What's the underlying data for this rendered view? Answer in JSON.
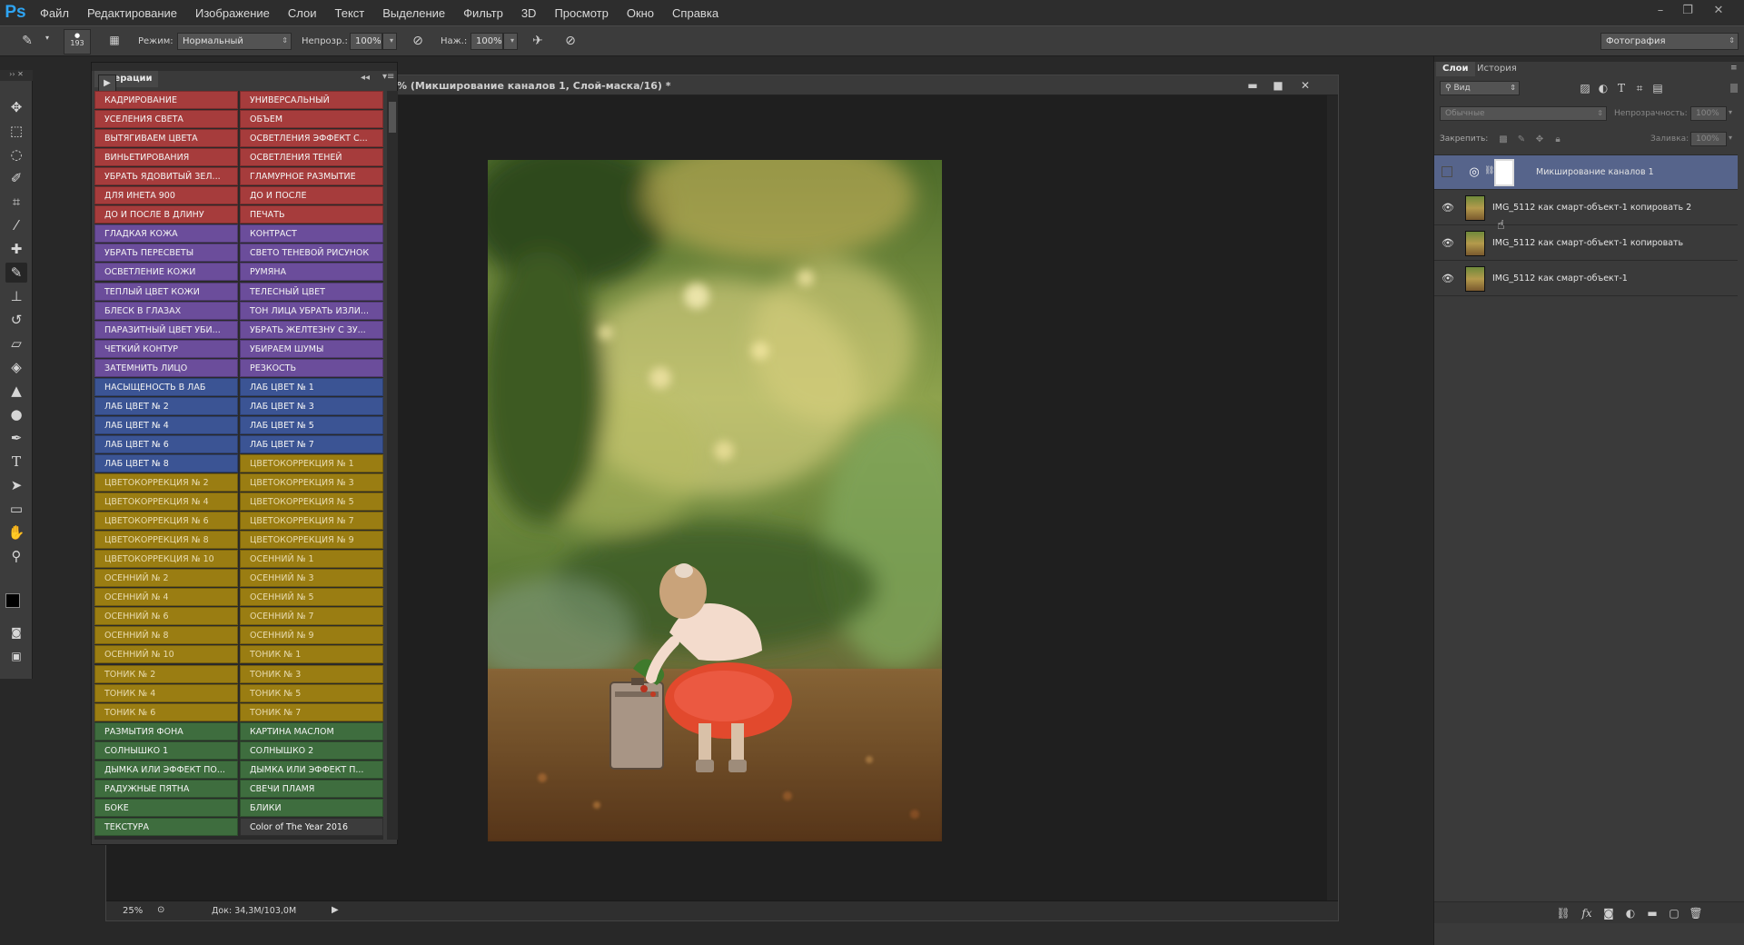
{
  "app": {
    "logo": "Ps"
  },
  "menu": [
    "Файл",
    "Редактирование",
    "Изображение",
    "Слои",
    "Текст",
    "Выделение",
    "Фильтр",
    "3D",
    "Просмотр",
    "Окно",
    "Справка"
  ],
  "options": {
    "brush_size": "193",
    "mode_label": "Режим:",
    "mode_value": "Нормальный",
    "opacity_label": "Непрозр.:",
    "opacity_value": "100%",
    "pressure_label": "Наж.:",
    "pressure_value": "100%",
    "workspace": "Фотография"
  },
  "document": {
    "title": "% (Микширование каналов 1, Слой-маска/16) *",
    "zoom": "25%",
    "doc_info": "Док: 34,3M/103,0M"
  },
  "actions_panel": {
    "tab": "Операции",
    "rows": [
      [
        "КАДРИРОВАНИЕ",
        "УНИВЕРСАЛЬНЫЙ",
        "red"
      ],
      [
        "УСЕЛЕНИЯ СВЕТА",
        "ОБЪЕМ",
        "red"
      ],
      [
        "ВЫТЯГИВАЕМ ЦВЕТА",
        "ОСВЕТЛЕНИЯ ЭФФЕКТ С...",
        "red"
      ],
      [
        "ВИНЬЕТИРОВАНИЯ",
        "ОСВЕТЛЕНИЯ ТЕНЕЙ",
        "red"
      ],
      [
        "УБРАТЬ ЯДОВИТЫЙ ЗЕЛ...",
        "ГЛАМУРНОЕ РАЗМЫТИЕ",
        "red"
      ],
      [
        "ДЛЯ ИНЕТА 900",
        "ДО И ПОСЛЕ",
        "red"
      ],
      [
        "ДО И ПОСЛЕ В ДЛИНУ",
        "ПЕЧАТЬ",
        "red"
      ],
      [
        "ГЛАДКАЯ КОЖА",
        "КОНТРАСТ",
        "purple"
      ],
      [
        "УБРАТЬ ПЕРЕСВЕТЫ",
        "СВЕТО ТЕНЕВОЙ РИСУНОК",
        "purple"
      ],
      [
        "ОСВЕТЛЕНИЕ КОЖИ",
        "РУМЯНА",
        "purple"
      ],
      [
        "ТЕПЛЫЙ ЦВЕТ КОЖИ",
        "ТЕЛЕСНЫЙ ЦВЕТ",
        "purple"
      ],
      [
        "БЛЕСК В ГЛАЗАХ",
        "ТОН ЛИЦА УБРАТЬ ИЗЛИ...",
        "purple"
      ],
      [
        "ПАРАЗИТНЫЙ ЦВЕТ УБИ...",
        "УБРАТЬ ЖЕЛТЕЗНУ С ЗУ...",
        "purple"
      ],
      [
        "ЧЕТКИЙ КОНТУР",
        "УБИРАЕМ ШУМЫ",
        "purple"
      ],
      [
        "ЗАТЕМНИТЬ ЛИЦО",
        "РЕЗКОСТЬ",
        "purple"
      ],
      [
        "НАСЫЩЕНОСТЬ В ЛАБ",
        "ЛАБ ЦВЕТ № 1",
        "blue"
      ],
      [
        "ЛАБ ЦВЕТ № 2",
        "ЛАБ ЦВЕТ № 3",
        "blue"
      ],
      [
        "ЛАБ ЦВЕТ № 4",
        "ЛАБ ЦВЕТ № 5",
        "blue"
      ],
      [
        "ЛАБ ЦВЕТ № 6",
        "ЛАБ ЦВЕТ № 7",
        "blue"
      ],
      [
        "ЛАБ ЦВЕТ № 8",
        "ЦВЕТОКОРРЕКЦИЯ № 1",
        "blue|yellow"
      ],
      [
        "ЦВЕТОКОРРЕКЦИЯ № 2",
        "ЦВЕТОКОРРЕКЦИЯ № 3",
        "yellow"
      ],
      [
        "ЦВЕТОКОРРЕКЦИЯ № 4",
        "ЦВЕТОКОРРЕКЦИЯ № 5",
        "yellow"
      ],
      [
        "ЦВЕТОКОРРЕКЦИЯ № 6",
        "ЦВЕТОКОРРЕКЦИЯ № 7",
        "yellow"
      ],
      [
        "ЦВЕТОКОРРЕКЦИЯ № 8",
        "ЦВЕТОКОРРЕКЦИЯ № 9",
        "yellow"
      ],
      [
        "ЦВЕТОКОРРЕКЦИЯ № 10",
        "ОСЕННИЙ № 1",
        "yellow"
      ],
      [
        "ОСЕННИЙ № 2",
        "ОСЕННИЙ № 3",
        "yellow"
      ],
      [
        "ОСЕННИЙ № 4",
        "ОСЕННИЙ № 5",
        "yellow"
      ],
      [
        "ОСЕННИЙ № 6",
        "ОСЕННИЙ № 7",
        "yellow"
      ],
      [
        "ОСЕННИЙ № 8",
        "ОСЕННИЙ № 9",
        "yellow"
      ],
      [
        "ОСЕННИЙ № 10",
        "ТОНИК № 1",
        "yellow"
      ],
      [
        "ТОНИК № 2",
        "ТОНИК № 3",
        "yellow"
      ],
      [
        "ТОНИК № 4",
        "ТОНИК № 5",
        "yellow"
      ],
      [
        "ТОНИК № 6",
        "ТОНИК № 7",
        "yellow"
      ],
      [
        "РАЗМЫТИЯ ФОНА",
        "КАРТИНА МАСЛОМ",
        "green"
      ],
      [
        "СОЛНЫШКО 1",
        "СОЛНЫШКО 2",
        "green"
      ],
      [
        "ДЫМКА ИЛИ ЭФФЕКТ ПО...",
        "ДЫМКА ИЛИ ЭФФЕКТ П...",
        "green"
      ],
      [
        "РАДУЖНЫЕ ПЯТНА",
        "СВЕЧИ ПЛАМЯ",
        "green"
      ],
      [
        "БОКЕ",
        "БЛИКИ",
        "green"
      ],
      [
        "ТЕКСТУРА",
        "Color of The Year 2016",
        "green|gray"
      ]
    ]
  },
  "layers_panel": {
    "tabs": [
      "Слои",
      "История"
    ],
    "filter": "Вид",
    "blend_mode": "Обычные",
    "opacity_label": "Непрозрачность:",
    "opacity_value": "100%",
    "lock_label": "Закрепить:",
    "fill_label": "Заливка:",
    "fill_value": "100%",
    "layers": [
      {
        "name": "Микширование каналов 1",
        "selected": true,
        "visible": false
      },
      {
        "name": "IMG_5112 как смарт-объект-1 копировать 2",
        "selected": false,
        "visible": true
      },
      {
        "name": "IMG_5112 как смарт-объект-1 копировать",
        "selected": false,
        "visible": true
      },
      {
        "name": "IMG_5112 как смарт-объект-1",
        "selected": false,
        "visible": true
      }
    ]
  },
  "colors": {
    "accent_blue": "#2ea4f2",
    "selected_layer": "#56648b"
  }
}
